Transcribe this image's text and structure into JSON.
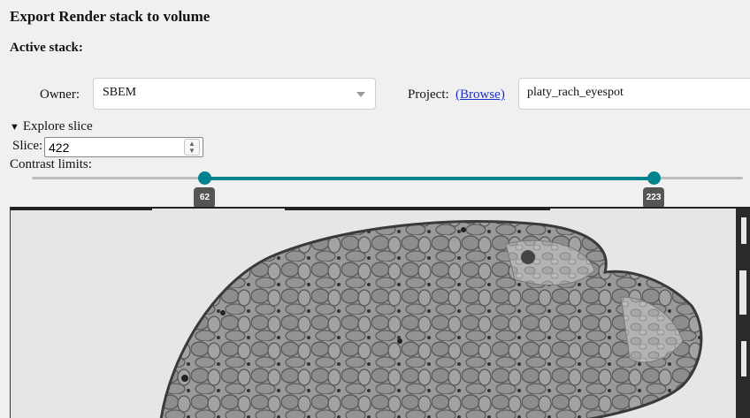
{
  "page": {
    "title": "Export Render stack to volume",
    "active_stack_label": "Active stack:"
  },
  "owner": {
    "label": "Owner:",
    "value": "SBEM"
  },
  "project": {
    "label": "Project:",
    "browse_link": "(Browse)",
    "value": "platy_rach_eyespot"
  },
  "explore": {
    "label": "Explore slice",
    "slice_label": "Slice:",
    "slice_value": "422",
    "contrast_label": "Contrast limits:"
  },
  "contrast": {
    "min": 0,
    "max": 255,
    "low": 62,
    "high": 223,
    "low_label": "62",
    "high_label": "223"
  },
  "colors": {
    "accent": "#00838f",
    "link": "#1a2fcf",
    "background": "#f0f0f0"
  },
  "icons": {
    "owner_dropdown": "chevron-down-icon",
    "explore_toggle": "triangle-down-icon",
    "slice_stepper": "up-down-stepper-icon"
  }
}
